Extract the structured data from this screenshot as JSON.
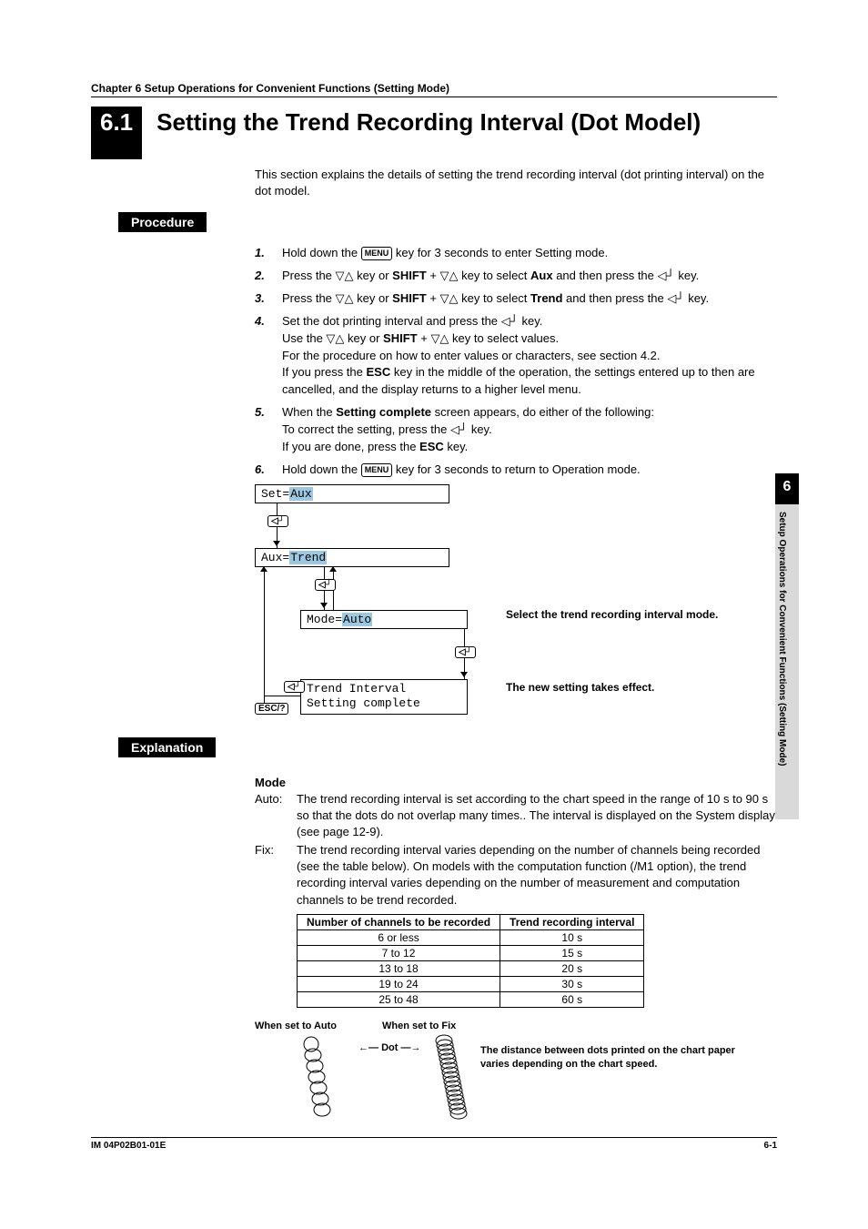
{
  "chapter_line": "Chapter 6     Setup Operations for Convenient Functions (Setting Mode)",
  "section_number": "6.1",
  "section_title": "Setting the Trend Recording Interval (Dot Model)",
  "intro": "This section explains the details of setting the trend recording interval (dot printing interval) on the dot model.",
  "band_procedure": "Procedure",
  "band_explanation": "Explanation",
  "keys": {
    "menu": "MENU",
    "shift": "SHIFT",
    "esc": "ESC",
    "esc_q": "ESC/?",
    "updown": "▽△",
    "enter": "◁┘"
  },
  "steps": [
    {
      "n": "1.",
      "parts": [
        {
          "t": "Hold down the "
        },
        {
          "kc": "menu"
        },
        {
          "t": " key for 3 seconds to enter Setting mode."
        }
      ]
    },
    {
      "n": "2.",
      "parts": [
        {
          "t": "Press the "
        },
        {
          "sym": "updown"
        },
        {
          "t": " key or "
        },
        {
          "b": "SHIFT"
        },
        {
          "t": " + "
        },
        {
          "sym": "updown"
        },
        {
          "t": " key to select "
        },
        {
          "b": "Aux"
        },
        {
          "t": " and then press the "
        },
        {
          "sym": "enter"
        },
        {
          "t": " key."
        }
      ]
    },
    {
      "n": "3.",
      "parts": [
        {
          "t": "Press the "
        },
        {
          "sym": "updown"
        },
        {
          "t": " key or "
        },
        {
          "b": "SHIFT"
        },
        {
          "t": " + "
        },
        {
          "sym": "updown"
        },
        {
          "t": " key to select "
        },
        {
          "b": "Trend"
        },
        {
          "t": " and then press the "
        },
        {
          "sym": "enter"
        },
        {
          "t": " key."
        }
      ]
    },
    {
      "n": "4.",
      "parts": [
        {
          "t": "Set the dot printing interval and press the "
        },
        {
          "sym": "enter"
        },
        {
          "t": " key."
        },
        {
          "br": true
        },
        {
          "t": "Use the "
        },
        {
          "sym": "updown"
        },
        {
          "t": " key or "
        },
        {
          "b": "SHIFT"
        },
        {
          "t": " + "
        },
        {
          "sym": "updown"
        },
        {
          "t": " key to select values."
        },
        {
          "br": true
        },
        {
          "t": "For the procedure on how to enter values or characters, see section 4.2."
        },
        {
          "br": true
        },
        {
          "t": "If you press the "
        },
        {
          "b": "ESC"
        },
        {
          "t": " key in the middle of the operation, the settings entered up to then are cancelled, and the display returns to a higher level menu."
        }
      ]
    },
    {
      "n": "5.",
      "parts": [
        {
          "t": "When the "
        },
        {
          "b": "Setting complete"
        },
        {
          "t": " screen appears, do either of the following:"
        },
        {
          "br": true
        },
        {
          "t": "To correct the setting, press the "
        },
        {
          "sym": "enter"
        },
        {
          "t": " key."
        },
        {
          "br": true
        },
        {
          "t": "If you are done, press the "
        },
        {
          "b": "ESC"
        },
        {
          "t": " key."
        }
      ]
    },
    {
      "n": "6.",
      "parts": [
        {
          "t": "Hold down the "
        },
        {
          "kc": "menu"
        },
        {
          "t": " key for 3 seconds to return to Operation mode."
        }
      ]
    }
  ],
  "flow": {
    "b1_pre": "Set=",
    "b1_hl": "Aux",
    "b2_pre": "Aux=",
    "b2_hl": "Trend",
    "b3_pre": "Mode=",
    "b3_hl": "Auto",
    "b4_l1": "Trend Interval",
    "b4_l2": "Setting complete",
    "label1": "Select the trend recording interval mode.",
    "label2": "The new setting takes effect."
  },
  "mode": {
    "heading": "Mode",
    "auto_label": "Auto:",
    "auto_text": "The trend recording interval is set according to the chart speed in the range of 10 s to 90 s so that the dots do not overlap many times.. The interval is displayed on the System display (see page 12-9).",
    "fix_label": "Fix:",
    "fix_text": "The trend recording interval varies depending on the number of channels being recorded (see the table below). On models with the computation function (/M1 option), the trend recording interval varies depending on the number of measurement and computation channels to be trend recorded."
  },
  "table": {
    "h1": "Number of channels to be recorded",
    "h2": "Trend recording interval",
    "rows": [
      [
        "6 or less",
        "10 s"
      ],
      [
        "7 to 12",
        "15 s"
      ],
      [
        "13 to 18",
        "20 s"
      ],
      [
        "19 to 24",
        "30 s"
      ],
      [
        "25 to 48",
        "60 s"
      ]
    ]
  },
  "dotfig": {
    "auto": "When set to Auto",
    "fix": "When set to Fix",
    "dot": "Dot",
    "note": "The distance between dots printed on the chart paper varies depending on the chart speed."
  },
  "side": {
    "num": "6",
    "text": "Setup Operations for Convenient Functions (Setting Mode)"
  },
  "footer": {
    "left": "IM 04P02B01-01E",
    "right": "6-1"
  },
  "chart_data": {
    "type": "table",
    "title": "Trend recording interval vs number of channels",
    "columns": [
      "Number of channels to be recorded",
      "Trend recording interval"
    ],
    "rows": [
      [
        "6 or less",
        "10 s"
      ],
      [
        "7 to 12",
        "15 s"
      ],
      [
        "13 to 18",
        "20 s"
      ],
      [
        "19 to 24",
        "30 s"
      ],
      [
        "25 to 48",
        "60 s"
      ]
    ]
  }
}
